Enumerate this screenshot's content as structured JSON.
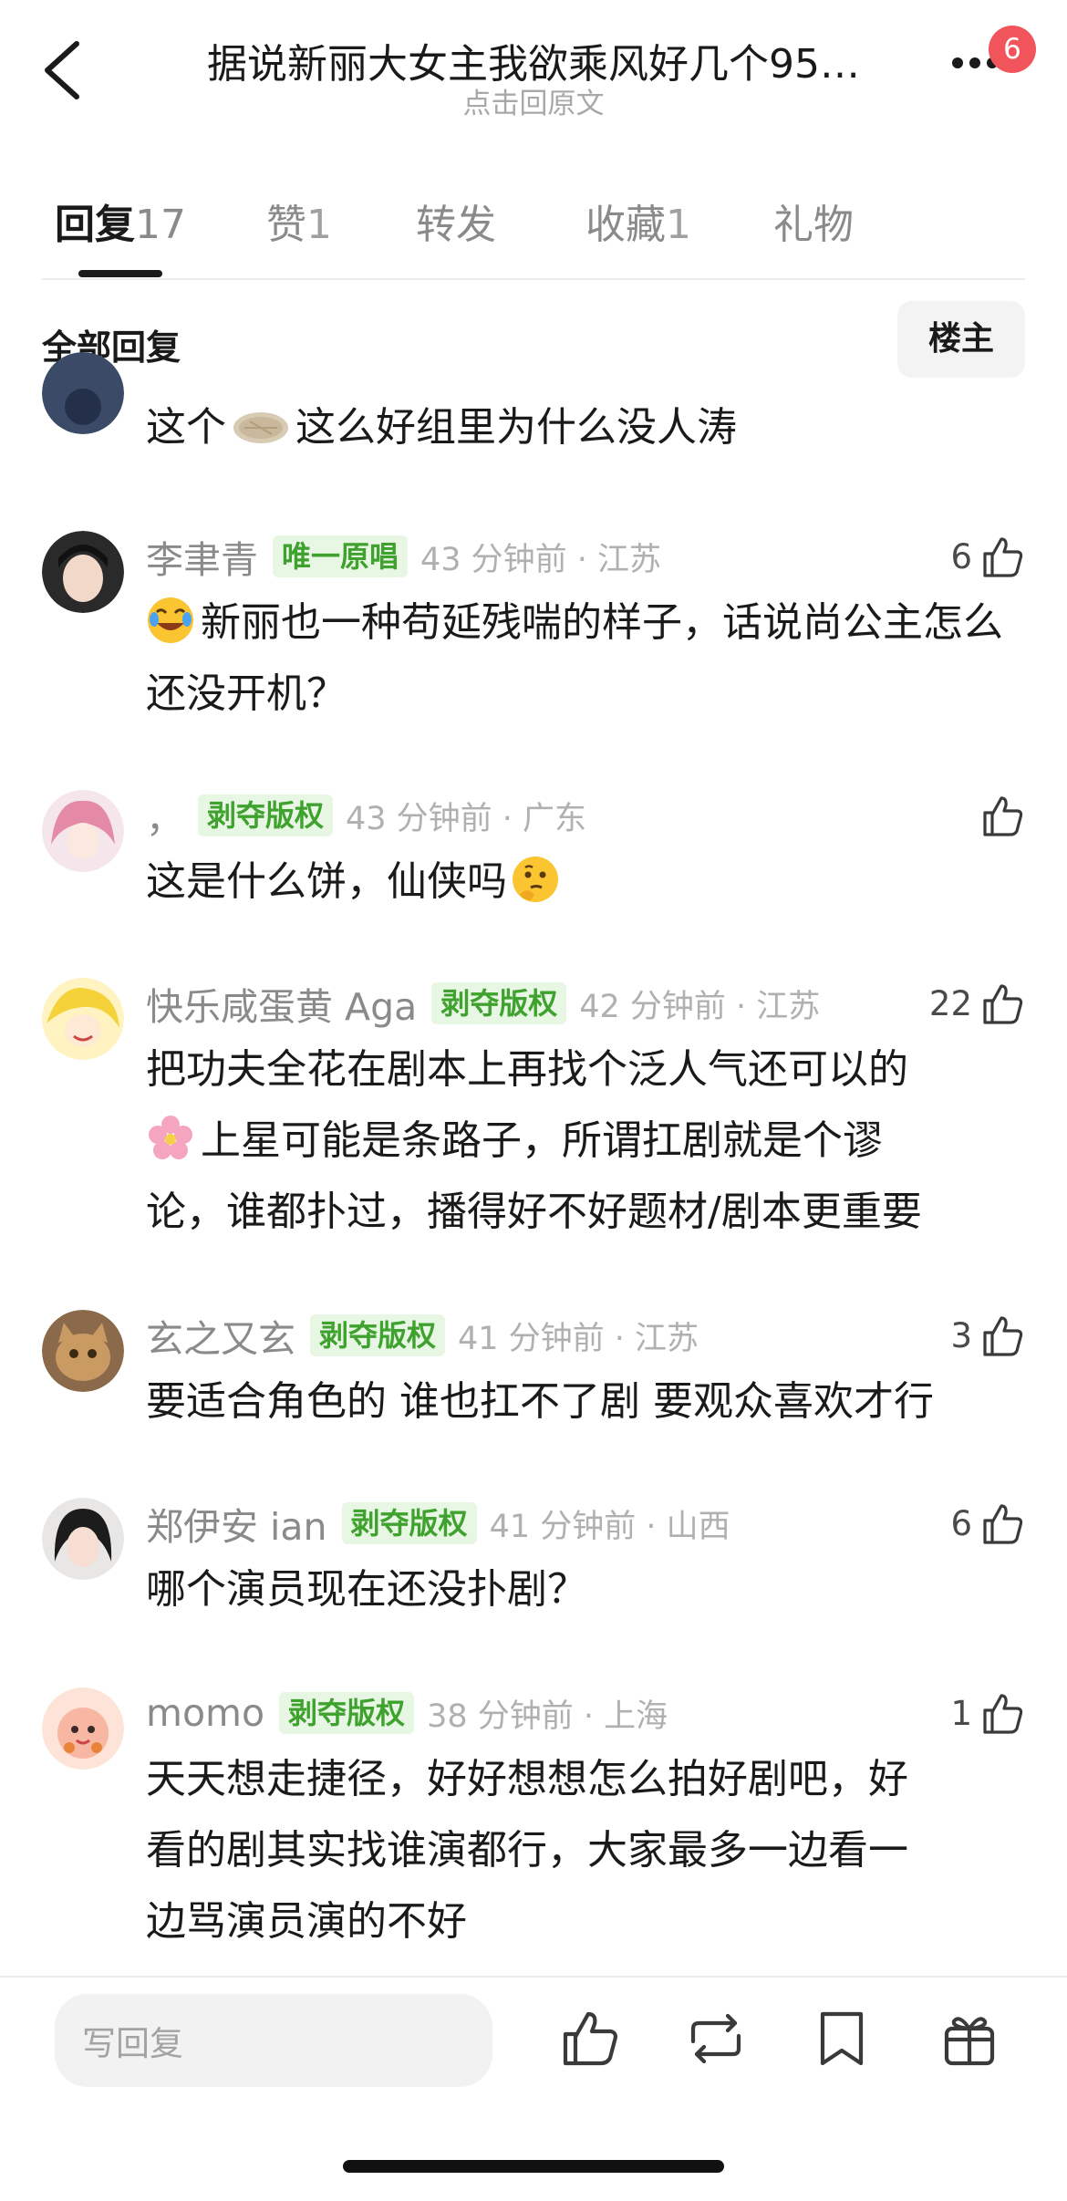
{
  "header": {
    "title": "据说新丽大女主我欲乘风好几个95…",
    "subtitle": "点击回原文",
    "notification_count": "6"
  },
  "tabs": [
    {
      "label": "回复",
      "count": "17"
    },
    {
      "label": "赞",
      "count": "1"
    },
    {
      "label": "转发",
      "count": ""
    },
    {
      "label": "收藏",
      "count": "1"
    },
    {
      "label": "礼物",
      "count": ""
    }
  ],
  "section": {
    "title": "全部回复",
    "filter_label": "楼主"
  },
  "partial_comment": {
    "text_before": "这个",
    "text_after": "这么好组里为什么没人涛"
  },
  "comments": [
    {
      "nick": "李聿青",
      "tag": "唯一原唱",
      "time": "43 分钟前 · 江苏",
      "likes": "6",
      "text": "新丽也一种苟延残喘的样子，话说尚公主怎么还没开机？",
      "emoji": "joy"
    },
    {
      "nick": "，",
      "tag": "剥夺版权",
      "time": "43 分钟前 · 广东",
      "likes": "",
      "text": "这是什么饼，仙侠吗",
      "emoji": "thinking"
    },
    {
      "nick": "快乐咸蛋黄 Aga",
      "tag": "剥夺版权",
      "time": "42 分钟前 · 江苏",
      "likes": "22",
      "text_line1": "把功夫全花在剧本上再找个泛人气还可以的",
      "text_line2": "上星可能是条路子，所谓扛剧就是个谬",
      "text_line3": "论，谁都扑过，播得好不好题材/剧本更重要",
      "emoji": "cherry-blossom"
    },
    {
      "nick": "玄之又玄",
      "tag": "剥夺版权",
      "time": "41 分钟前 · 江苏",
      "likes": "3",
      "text": "要适合角色的 谁也扛不了剧 要观众喜欢才行"
    },
    {
      "nick": "郑伊安 ian",
      "tag": "剥夺版权",
      "time": "41 分钟前 · 山西",
      "likes": "6",
      "text": "哪个演员现在还没扑剧？"
    },
    {
      "nick": "momo",
      "tag": "剥夺版权",
      "time": "38 分钟前 · 上海",
      "likes": "1",
      "text_line1": "天天想走捷径，好好想想怎么拍好剧吧，好",
      "text_line2": "看的剧其实找谁演都行，大家最多一边看一",
      "text_line3": "边骂演员演的不好"
    }
  ],
  "bottom_bar": {
    "reply_placeholder": "写回复",
    "icons": [
      "like-icon",
      "repost-icon",
      "bookmark-icon",
      "gift-icon"
    ]
  },
  "colors": {
    "tag_bg": "#e8f6e4",
    "tag_text": "#3fa22e",
    "badge": "#f2545b"
  }
}
